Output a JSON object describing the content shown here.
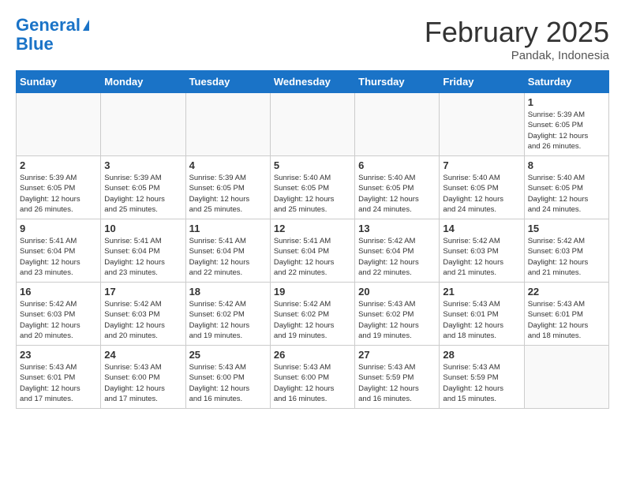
{
  "header": {
    "logo_line1": "General",
    "logo_line2": "Blue",
    "month": "February 2025",
    "location": "Pandak, Indonesia"
  },
  "weekdays": [
    "Sunday",
    "Monday",
    "Tuesday",
    "Wednesday",
    "Thursday",
    "Friday",
    "Saturday"
  ],
  "weeks": [
    [
      {
        "day": "",
        "info": ""
      },
      {
        "day": "",
        "info": ""
      },
      {
        "day": "",
        "info": ""
      },
      {
        "day": "",
        "info": ""
      },
      {
        "day": "",
        "info": ""
      },
      {
        "day": "",
        "info": ""
      },
      {
        "day": "1",
        "info": "Sunrise: 5:39 AM\nSunset: 6:05 PM\nDaylight: 12 hours\nand 26 minutes."
      }
    ],
    [
      {
        "day": "2",
        "info": "Sunrise: 5:39 AM\nSunset: 6:05 PM\nDaylight: 12 hours\nand 26 minutes."
      },
      {
        "day": "3",
        "info": "Sunrise: 5:39 AM\nSunset: 6:05 PM\nDaylight: 12 hours\nand 25 minutes."
      },
      {
        "day": "4",
        "info": "Sunrise: 5:39 AM\nSunset: 6:05 PM\nDaylight: 12 hours\nand 25 minutes."
      },
      {
        "day": "5",
        "info": "Sunrise: 5:40 AM\nSunset: 6:05 PM\nDaylight: 12 hours\nand 25 minutes."
      },
      {
        "day": "6",
        "info": "Sunrise: 5:40 AM\nSunset: 6:05 PM\nDaylight: 12 hours\nand 24 minutes."
      },
      {
        "day": "7",
        "info": "Sunrise: 5:40 AM\nSunset: 6:05 PM\nDaylight: 12 hours\nand 24 minutes."
      },
      {
        "day": "8",
        "info": "Sunrise: 5:40 AM\nSunset: 6:05 PM\nDaylight: 12 hours\nand 24 minutes."
      }
    ],
    [
      {
        "day": "9",
        "info": "Sunrise: 5:41 AM\nSunset: 6:04 PM\nDaylight: 12 hours\nand 23 minutes."
      },
      {
        "day": "10",
        "info": "Sunrise: 5:41 AM\nSunset: 6:04 PM\nDaylight: 12 hours\nand 23 minutes."
      },
      {
        "day": "11",
        "info": "Sunrise: 5:41 AM\nSunset: 6:04 PM\nDaylight: 12 hours\nand 22 minutes."
      },
      {
        "day": "12",
        "info": "Sunrise: 5:41 AM\nSunset: 6:04 PM\nDaylight: 12 hours\nand 22 minutes."
      },
      {
        "day": "13",
        "info": "Sunrise: 5:42 AM\nSunset: 6:04 PM\nDaylight: 12 hours\nand 22 minutes."
      },
      {
        "day": "14",
        "info": "Sunrise: 5:42 AM\nSunset: 6:03 PM\nDaylight: 12 hours\nand 21 minutes."
      },
      {
        "day": "15",
        "info": "Sunrise: 5:42 AM\nSunset: 6:03 PM\nDaylight: 12 hours\nand 21 minutes."
      }
    ],
    [
      {
        "day": "16",
        "info": "Sunrise: 5:42 AM\nSunset: 6:03 PM\nDaylight: 12 hours\nand 20 minutes."
      },
      {
        "day": "17",
        "info": "Sunrise: 5:42 AM\nSunset: 6:03 PM\nDaylight: 12 hours\nand 20 minutes."
      },
      {
        "day": "18",
        "info": "Sunrise: 5:42 AM\nSunset: 6:02 PM\nDaylight: 12 hours\nand 19 minutes."
      },
      {
        "day": "19",
        "info": "Sunrise: 5:42 AM\nSunset: 6:02 PM\nDaylight: 12 hours\nand 19 minutes."
      },
      {
        "day": "20",
        "info": "Sunrise: 5:43 AM\nSunset: 6:02 PM\nDaylight: 12 hours\nand 19 minutes."
      },
      {
        "day": "21",
        "info": "Sunrise: 5:43 AM\nSunset: 6:01 PM\nDaylight: 12 hours\nand 18 minutes."
      },
      {
        "day": "22",
        "info": "Sunrise: 5:43 AM\nSunset: 6:01 PM\nDaylight: 12 hours\nand 18 minutes."
      }
    ],
    [
      {
        "day": "23",
        "info": "Sunrise: 5:43 AM\nSunset: 6:01 PM\nDaylight: 12 hours\nand 17 minutes."
      },
      {
        "day": "24",
        "info": "Sunrise: 5:43 AM\nSunset: 6:00 PM\nDaylight: 12 hours\nand 17 minutes."
      },
      {
        "day": "25",
        "info": "Sunrise: 5:43 AM\nSunset: 6:00 PM\nDaylight: 12 hours\nand 16 minutes."
      },
      {
        "day": "26",
        "info": "Sunrise: 5:43 AM\nSunset: 6:00 PM\nDaylight: 12 hours\nand 16 minutes."
      },
      {
        "day": "27",
        "info": "Sunrise: 5:43 AM\nSunset: 5:59 PM\nDaylight: 12 hours\nand 16 minutes."
      },
      {
        "day": "28",
        "info": "Sunrise: 5:43 AM\nSunset: 5:59 PM\nDaylight: 12 hours\nand 15 minutes."
      },
      {
        "day": "",
        "info": ""
      }
    ]
  ]
}
